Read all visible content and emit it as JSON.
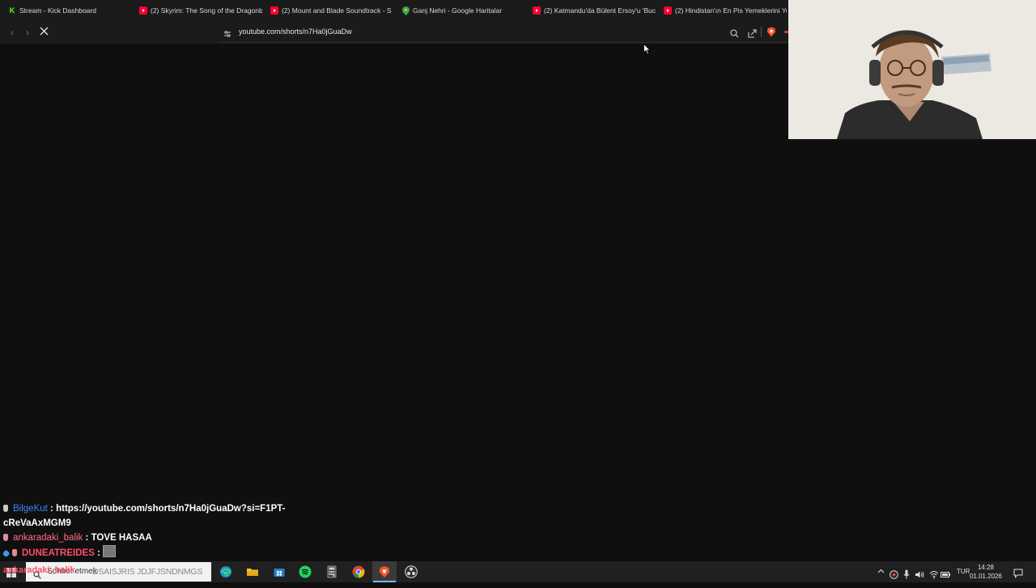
{
  "browser": {
    "tabs": [
      {
        "title": "Stream - Kick Dashboard",
        "icon": "kick-icon"
      },
      {
        "title": "(2) Skyrim: The Song of the Dragonb",
        "icon": "youtube-icon"
      },
      {
        "title": "(2) Mount and Blade Soundtrack - S",
        "icon": "youtube-icon"
      },
      {
        "title": "Ganj Nehri - Google Haritalar",
        "icon": "google-maps-icon"
      },
      {
        "title": "(2) Katmandu'da Bülent Ersoy'u 'Buc",
        "icon": "youtube-icon"
      },
      {
        "title": "(2) Hindistan'ın En Pis Yemeklerini Ye",
        "icon": "youtube-icon"
      }
    ],
    "url": "youtube.com/shorts/n7Ha0jGuaDw",
    "brand_color": "#fb542b"
  },
  "chat": {
    "messages": [
      {
        "user": "BilgeKut",
        "text": "https://youtube.com/shorts/n7Ha0jGuaDw?si=F1PT-cReVaAxMGM9"
      },
      {
        "user": "ankaradaki_balik",
        "text": "TOVE HASAA"
      },
      {
        "user": "DUNEATREIDES",
        "text": ""
      }
    ],
    "separator": ":"
  },
  "taskbar": {
    "search_placeholder": "Sohbet etmek",
    "overlay_text": "DSAISJRIS JDJFJSNDNMGS",
    "overlay_name": "ankaradaki_balik",
    "tray_language": "TUR",
    "time": "14:28",
    "date": "01.01.2026"
  }
}
